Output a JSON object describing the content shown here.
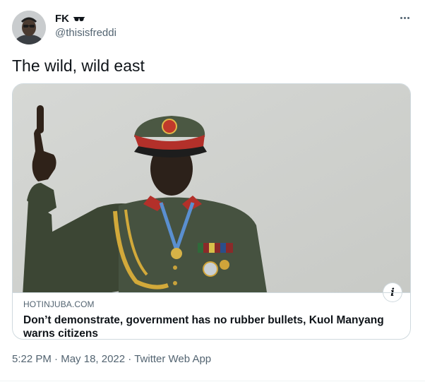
{
  "author": {
    "display_name": "FK",
    "badge_icon": "sunglasses-icon",
    "handle": "@thisisfreddi"
  },
  "tweet": {
    "text": "The wild, wild east"
  },
  "card": {
    "image_icon": "article-photo",
    "domain": "HOTINJUBA.COM",
    "title": "Don’t demonstrate, government has no rubber bullets, Kuol Manyang warns citizens",
    "info_icon": "info-icon",
    "info_symbol": "i"
  },
  "meta": {
    "time": "5:22 PM",
    "date": "May 18, 2022",
    "source": "Twitter Web App",
    "separator": "·"
  },
  "colors": {
    "text_primary": "#0f1419",
    "text_secondary": "#536471",
    "border": "#cfd9de"
  }
}
